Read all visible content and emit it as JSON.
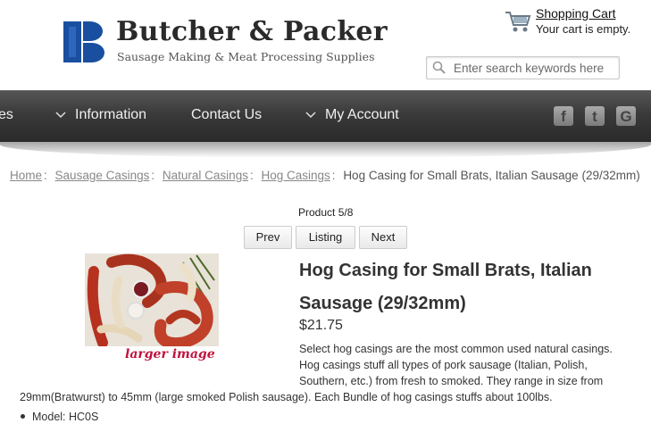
{
  "brand": {
    "name": "Butcher & Packer",
    "tagline": "Sausage Making & Meat Processing Supplies"
  },
  "cart": {
    "title": "Shopping Cart",
    "status": "Your cart is empty."
  },
  "search": {
    "placeholder": "Enter search keywords here"
  },
  "nav": {
    "items": [
      "es",
      "Information",
      "Contact Us",
      "My Account"
    ],
    "social": [
      "f",
      "t",
      "G"
    ]
  },
  "breadcrumb": {
    "links": [
      "Home",
      "Sausage Casings",
      "Natural Casings",
      "Hog Casings"
    ],
    "separator": ":",
    "current": "Hog Casing for Small Brats, Italian Sausage (29/32mm)"
  },
  "product_nav": {
    "count": "Product 5/8",
    "prev": "Prev",
    "listing": "Listing",
    "next": "Next"
  },
  "product": {
    "title": "Hog Casing for Small Brats, Italian Sausage (29/32mm)",
    "price": "$21.75",
    "larger_image": "larger image",
    "description_part1": "Select hog casings are the most common used natural casings. Hog casings stuff all types of pork sausage (Italian, Polish, Southern, etc.) from fresh to smoked. They range in size from",
    "description_part2": "29mm(Bratwurst) to 45mm (large smoked Polish sausage). Each Bundle of hog casings stuffs about 100lbs.",
    "model": "Model: HC0S"
  },
  "colors": {
    "logo_blue": "#1a4fa0",
    "nav_bg": "#3a3a3a",
    "accent_red": "#c0123c"
  }
}
